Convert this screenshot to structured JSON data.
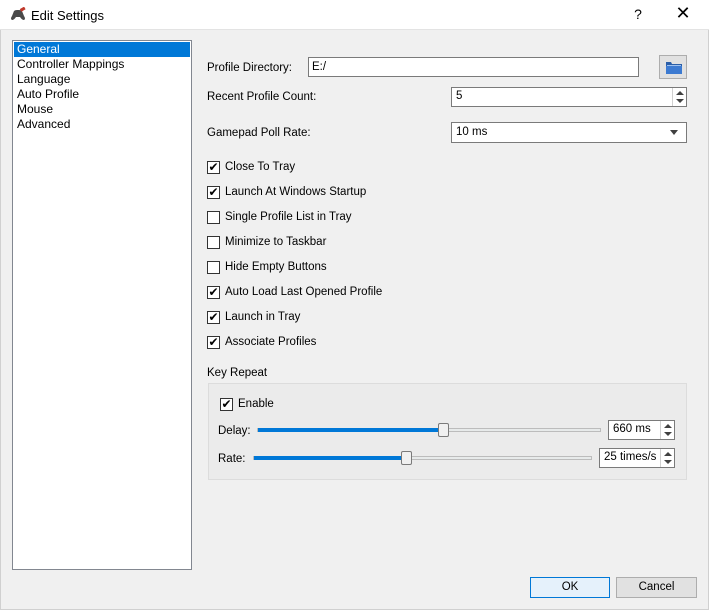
{
  "window": {
    "title": "Edit Settings",
    "help": "?",
    "close": "✕"
  },
  "nav": {
    "items": [
      "General",
      "Controller Mappings",
      "Language",
      "Auto Profile",
      "Mouse",
      "Advanced"
    ],
    "selected": "General"
  },
  "general": {
    "profile_directory_label": "Profile Directory:",
    "profile_directory_value": "E:/",
    "recent_profile_count_label": "Recent Profile Count:",
    "recent_profile_count_value": "5",
    "gamepad_poll_rate_label": "Gamepad Poll Rate:",
    "gamepad_poll_rate_value": "10 ms",
    "checkboxes": [
      {
        "label": "Close To Tray",
        "checked": true
      },
      {
        "label": "Launch At Windows Startup",
        "checked": true
      },
      {
        "label": "Single Profile List in Tray",
        "checked": false
      },
      {
        "label": "Minimize to Taskbar",
        "checked": false
      },
      {
        "label": "Hide Empty Buttons",
        "checked": false
      },
      {
        "label": "Auto Load Last Opened Profile",
        "checked": true
      },
      {
        "label": "Launch in Tray",
        "checked": true
      },
      {
        "label": "Associate Profiles",
        "checked": true
      }
    ]
  },
  "key_repeat": {
    "title": "Key Repeat",
    "enable_label": "Enable",
    "enable_checked": true,
    "delay_label": "Delay:",
    "delay_value": "660 ms",
    "delay_fraction": 0.54,
    "rate_label": "Rate:",
    "rate_value": "25 times/s",
    "rate_fraction": 0.45
  },
  "footer": {
    "ok_label": "OK",
    "cancel_label": "Cancel"
  }
}
